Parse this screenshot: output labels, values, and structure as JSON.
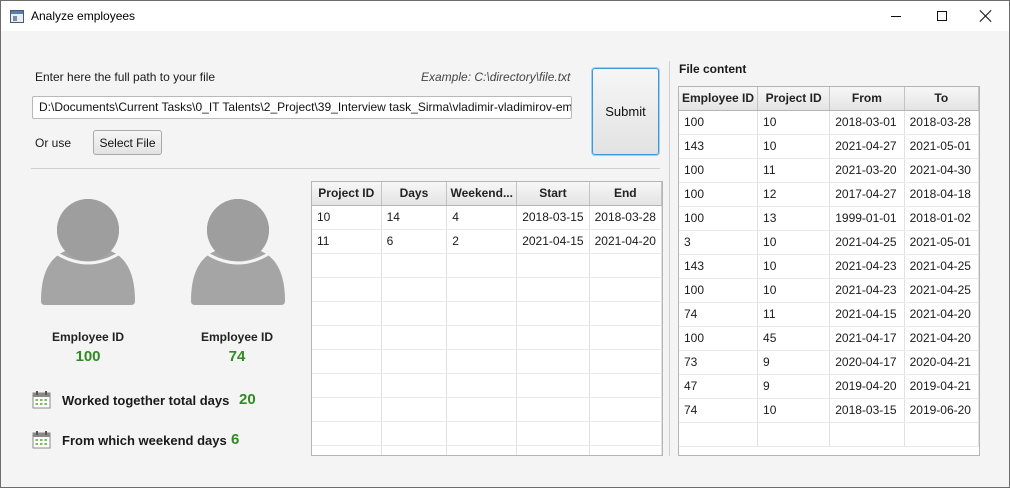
{
  "window": {
    "title": "Analyze employees"
  },
  "form": {
    "prompt_label": "Enter here the full path to your file",
    "example_label": "Example: C:\\directory\\file.txt",
    "path_value": "D:\\Documents\\Current Tasks\\0_IT Talents\\2_Project\\39_Interview task_Sirma\\vladimir-vladimirov-em",
    "or_use_label": "Or use",
    "select_file_label": "Select File",
    "submit_label": "Submit"
  },
  "pair": {
    "employee_label_1": "Employee ID",
    "employee_id_1": "100",
    "employee_label_2": "Employee ID",
    "employee_id_2": "74"
  },
  "stats": {
    "total_label": "Worked together total days",
    "total_value": "20",
    "weekend_label": "From which weekend days",
    "weekend_value": "6"
  },
  "projects_table": {
    "columns": [
      "Project ID",
      "Days",
      "Weekend...",
      "Start",
      "End"
    ],
    "rows": [
      [
        "10",
        "14",
        "4",
        "2018-03-15",
        "2018-03-28"
      ],
      [
        "11",
        "6",
        "2",
        "2021-04-15",
        "2021-04-20"
      ]
    ]
  },
  "file_content": {
    "title": "File content",
    "columns": [
      "Employee ID",
      "Project ID",
      "From",
      "To"
    ],
    "rows": [
      [
        "100",
        "10",
        "2018-03-01",
        "2018-03-28"
      ],
      [
        "143",
        "10",
        "2021-04-27",
        "2021-05-01"
      ],
      [
        "100",
        "11",
        "2021-03-20",
        "2021-04-30"
      ],
      [
        "100",
        "12",
        "2017-04-27",
        "2018-04-18"
      ],
      [
        "100",
        "13",
        "1999-01-01",
        "2018-01-02"
      ],
      [
        "3",
        "10",
        "2021-04-25",
        "2021-05-01"
      ],
      [
        "143",
        "10",
        "2021-04-23",
        "2021-04-25"
      ],
      [
        "100",
        "10",
        "2021-04-23",
        "2021-04-25"
      ],
      [
        "74",
        "11",
        "2021-04-15",
        "2021-04-20"
      ],
      [
        "100",
        "45",
        "2021-04-17",
        "2021-04-20"
      ],
      [
        "73",
        "9",
        "2020-04-17",
        "2020-04-21"
      ],
      [
        "47",
        "9",
        "2019-04-20",
        "2019-04-21"
      ],
      [
        "74",
        "10",
        "2018-03-15",
        "2019-06-20"
      ]
    ]
  },
  "icons": {
    "app": "window-app-icon",
    "avatar": "person-avatar-icon",
    "calendar": "calendar-icon"
  },
  "colors": {
    "accent_value": "#2e8b22",
    "submit_focus": "#3a9ad9"
  }
}
